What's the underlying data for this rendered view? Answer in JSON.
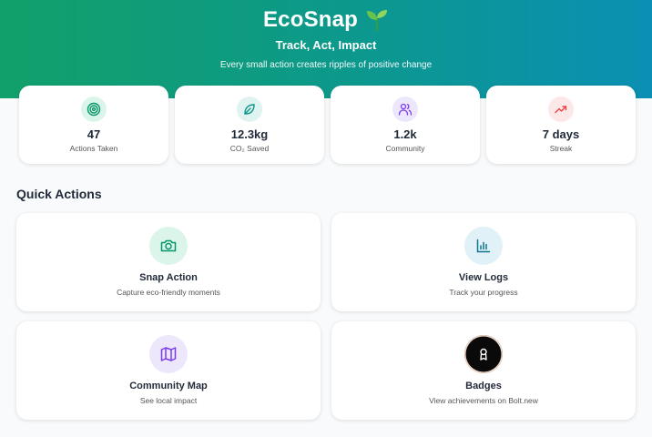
{
  "header": {
    "title": "EcoSnap",
    "tagline": "Track, Act, Impact",
    "subtitle": "Every small action creates ripples of positive change",
    "icon": "sprout-icon"
  },
  "stats": [
    {
      "value": "47",
      "label": "Actions Taken",
      "icon": "target-icon",
      "color": "#059669"
    },
    {
      "value": "12.3kg",
      "label": "CO₂ Saved",
      "icon": "leaf-icon",
      "color": "#0d9488"
    },
    {
      "value": "1.2k",
      "label": "Community",
      "icon": "users-icon",
      "color": "#7c3aed"
    },
    {
      "value": "7 days",
      "label": "Streak",
      "icon": "trending-up-icon",
      "color": "#ef4444"
    }
  ],
  "quick_actions": {
    "title": "Quick Actions",
    "items": [
      {
        "title": "Snap Action",
        "subtitle": "Capture eco-friendly moments",
        "icon": "camera-icon"
      },
      {
        "title": "View Logs",
        "subtitle": "Track your progress",
        "icon": "bar-chart-icon"
      },
      {
        "title": "Community Map",
        "subtitle": "See local impact",
        "icon": "map-icon"
      },
      {
        "title": "Badges",
        "subtitle": "View achievements on Bolt.new",
        "icon": "badge-icon"
      }
    ]
  }
}
